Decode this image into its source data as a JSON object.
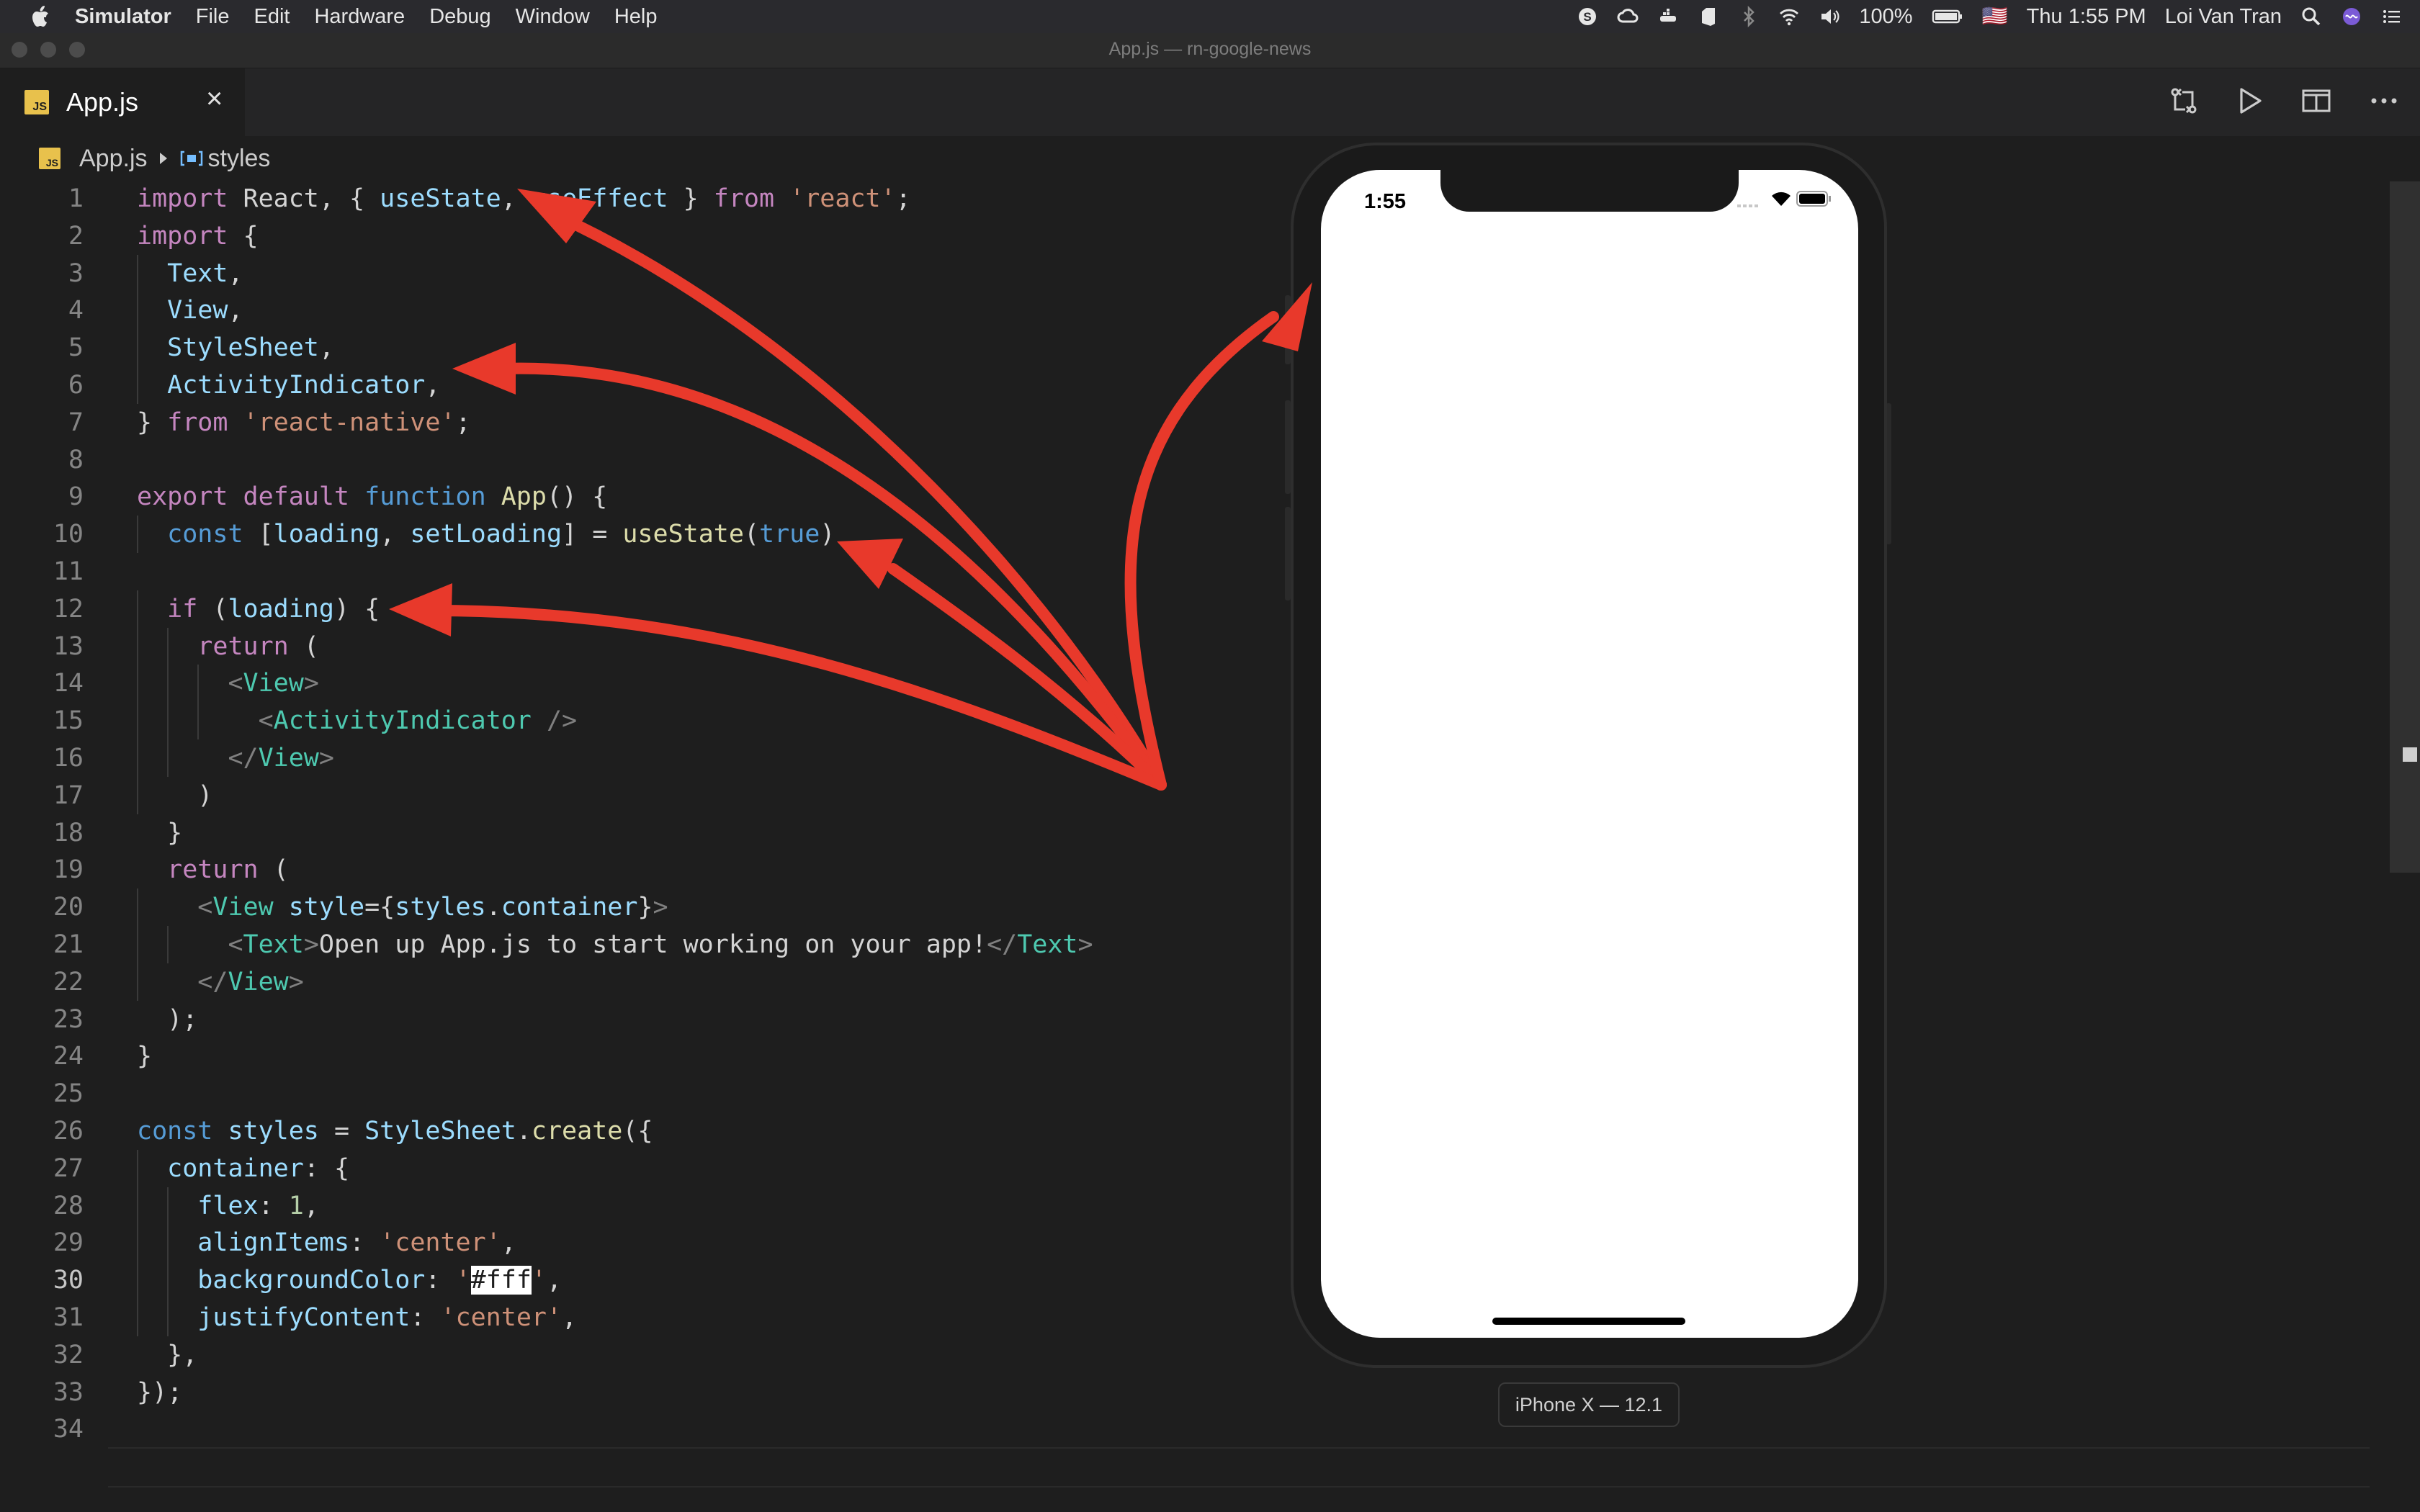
{
  "menubar": {
    "app_name": "Simulator",
    "items": [
      "File",
      "Edit",
      "Hardware",
      "Debug",
      "Window",
      "Help"
    ],
    "battery": "100%",
    "flag": "🇺🇸",
    "clock": "Thu 1:55 PM",
    "user": "Loi Van Tran"
  },
  "window": {
    "title": "App.js — rn-google-news"
  },
  "tab": {
    "badge": "JS",
    "name": "App.js",
    "close": "×"
  },
  "breadcrumb": {
    "file": "App.js",
    "symbol": "styles"
  },
  "code_lines": [
    [
      {
        "t": "import ",
        "c": "kw"
      },
      {
        "t": "React, { "
      },
      {
        "t": "useState",
        "c": "var"
      },
      {
        "t": ", "
      },
      {
        "t": "useEffect",
        "c": "var"
      },
      {
        "t": " } "
      },
      {
        "t": "from ",
        "c": "kw"
      },
      {
        "t": "'react'",
        "c": "str"
      },
      {
        "t": ";"
      }
    ],
    [
      {
        "t": "import ",
        "c": "kw"
      },
      {
        "t": "{"
      }
    ],
    [
      {
        "t": "  "
      },
      {
        "t": "Text",
        "c": "var"
      },
      {
        "t": ","
      }
    ],
    [
      {
        "t": "  "
      },
      {
        "t": "View",
        "c": "var"
      },
      {
        "t": ","
      }
    ],
    [
      {
        "t": "  "
      },
      {
        "t": "StyleSheet",
        "c": "var"
      },
      {
        "t": ","
      }
    ],
    [
      {
        "t": "  "
      },
      {
        "t": "ActivityIndicator",
        "c": "var"
      },
      {
        "t": ","
      }
    ],
    [
      {
        "t": "} "
      },
      {
        "t": "from ",
        "c": "kw"
      },
      {
        "t": "'react-native'",
        "c": "str"
      },
      {
        "t": ";"
      }
    ],
    [],
    [
      {
        "t": "export default ",
        "c": "kw"
      },
      {
        "t": "function ",
        "c": "kb"
      },
      {
        "t": "App",
        "c": "fn"
      },
      {
        "t": "() {"
      }
    ],
    [
      {
        "t": "  "
      },
      {
        "t": "const ",
        "c": "kb"
      },
      {
        "t": "["
      },
      {
        "t": "loading",
        "c": "var"
      },
      {
        "t": ", "
      },
      {
        "t": "setLoading",
        "c": "var"
      },
      {
        "t": "] = "
      },
      {
        "t": "useState",
        "c": "fn"
      },
      {
        "t": "("
      },
      {
        "t": "true",
        "c": "kb"
      },
      {
        "t": ")"
      }
    ],
    [],
    [
      {
        "t": "  "
      },
      {
        "t": "if ",
        "c": "kw"
      },
      {
        "t": "("
      },
      {
        "t": "loading",
        "c": "var"
      },
      {
        "t": ") {"
      }
    ],
    [
      {
        "t": "    "
      },
      {
        "t": "return ",
        "c": "kw"
      },
      {
        "t": "("
      }
    ],
    [
      {
        "t": "      "
      },
      {
        "t": "<",
        "c": "br"
      },
      {
        "t": "View",
        "c": "tg"
      },
      {
        "t": ">",
        "c": "br"
      }
    ],
    [
      {
        "t": "        "
      },
      {
        "t": "<",
        "c": "br"
      },
      {
        "t": "ActivityIndicator",
        "c": "tg"
      },
      {
        "t": " />",
        "c": "br"
      }
    ],
    [
      {
        "t": "      "
      },
      {
        "t": "</",
        "c": "br"
      },
      {
        "t": "View",
        "c": "tg"
      },
      {
        "t": ">",
        "c": "br"
      }
    ],
    [
      {
        "t": "    )"
      }
    ],
    [
      {
        "t": "  }"
      }
    ],
    [
      {
        "t": "  "
      },
      {
        "t": "return ",
        "c": "kw"
      },
      {
        "t": "("
      }
    ],
    [
      {
        "t": "    "
      },
      {
        "t": "<",
        "c": "br"
      },
      {
        "t": "View ",
        "c": "tg"
      },
      {
        "t": "style",
        "c": "var"
      },
      {
        "t": "={"
      },
      {
        "t": "styles",
        "c": "var"
      },
      {
        "t": "."
      },
      {
        "t": "container",
        "c": "var"
      },
      {
        "t": "}"
      },
      {
        "t": ">",
        "c": "br"
      }
    ],
    [
      {
        "t": "      "
      },
      {
        "t": "<",
        "c": "br"
      },
      {
        "t": "Text",
        "c": "tg"
      },
      {
        "t": ">",
        "c": "br"
      },
      {
        "t": "Open up App.js to start working on your app!"
      },
      {
        "t": "</",
        "c": "br"
      },
      {
        "t": "Text",
        "c": "tg"
      },
      {
        "t": ">",
        "c": "br"
      }
    ],
    [
      {
        "t": "    "
      },
      {
        "t": "</",
        "c": "br"
      },
      {
        "t": "View",
        "c": "tg"
      },
      {
        "t": ">",
        "c": "br"
      }
    ],
    [
      {
        "t": "  );"
      }
    ],
    [
      {
        "t": "}"
      }
    ],
    [],
    [
      {
        "t": "const ",
        "c": "kb"
      },
      {
        "t": "styles",
        "c": "var"
      },
      {
        "t": " = "
      },
      {
        "t": "StyleSheet",
        "c": "var"
      },
      {
        "t": "."
      },
      {
        "t": "create",
        "c": "fn"
      },
      {
        "t": "({"
      }
    ],
    [
      {
        "t": "  "
      },
      {
        "t": "container",
        "c": "var"
      },
      {
        "t": ": {"
      }
    ],
    [
      {
        "t": "    "
      },
      {
        "t": "flex",
        "c": "var"
      },
      {
        "t": ": "
      },
      {
        "t": "1",
        "c": "num"
      },
      {
        "t": ","
      }
    ],
    [
      {
        "t": "    "
      },
      {
        "t": "alignItems",
        "c": "var"
      },
      {
        "t": ": "
      },
      {
        "t": "'center'",
        "c": "str"
      },
      {
        "t": ","
      }
    ],
    [
      {
        "t": "    "
      },
      {
        "t": "backgroundColor",
        "c": "var"
      },
      {
        "t": ": "
      },
      {
        "t": "'",
        "c": "str"
      },
      {
        "t": "#fff",
        "c": "sel"
      },
      {
        "t": "'",
        "c": "str"
      },
      {
        "t": ","
      }
    ],
    [
      {
        "t": "    "
      },
      {
        "t": "justifyContent",
        "c": "var"
      },
      {
        "t": ": "
      },
      {
        "t": "'center'",
        "c": "str"
      },
      {
        "t": ","
      }
    ],
    [
      {
        "t": "  },"
      }
    ],
    [
      {
        "t": "});"
      }
    ],
    []
  ],
  "current_line": 30,
  "phone": {
    "time": "1:55",
    "device_label": "iPhone X — 12.1"
  },
  "colors": {
    "arrow": "#e8392b",
    "editor_bg": "#1e1e1e",
    "js_badge": "#e8c14c"
  }
}
